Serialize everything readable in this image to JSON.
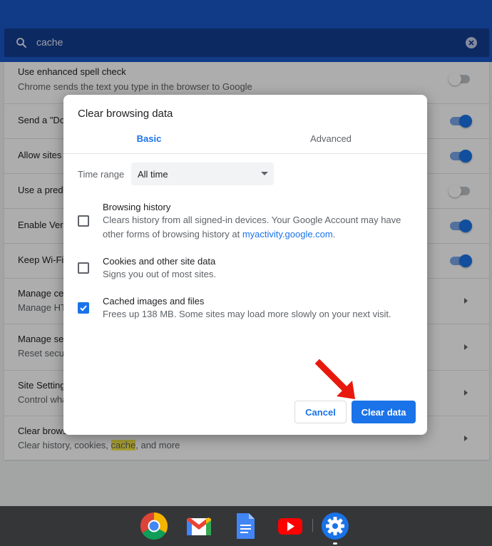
{
  "search": {
    "query": "cache"
  },
  "settings": {
    "rows": [
      {
        "title": "Use enhanced spell check",
        "subtitle": "Chrome sends the text you type in the browser to Google",
        "toggle": "off"
      },
      {
        "title": "Send a \"Do",
        "subtitle": "",
        "toggle": "on"
      },
      {
        "title": "Allow sites",
        "subtitle": "",
        "toggle": "on"
      },
      {
        "title": "Use a predi",
        "subtitle": "",
        "toggle": "off"
      },
      {
        "title": "Enable Veri",
        "subtitle": "",
        "toggle": "on"
      },
      {
        "title": "Keep Wi-Fi",
        "subtitle": "",
        "toggle": "on"
      },
      {
        "title": "Manage ce",
        "subtitle": "Manage HT",
        "toggle": "chevron"
      },
      {
        "title": "Manage se",
        "subtitle": "Reset secu",
        "toggle": "chevron"
      },
      {
        "title": "Site Setting",
        "subtitle": "Control wha",
        "toggle": "chevron"
      },
      {
        "title": "Clear brows",
        "subtitle_pre": "Clear history, cookies, ",
        "subtitle_hl": "cache",
        "subtitle_post": ", and more",
        "toggle": "chevron"
      }
    ]
  },
  "dialog": {
    "title": "Clear browsing data",
    "tabs": [
      "Basic",
      "Advanced"
    ],
    "time_range_label": "Time range",
    "time_range_value": "All time",
    "options": [
      {
        "title": "Browsing history",
        "desc_pre": "Clears history from all signed-in devices. Your Google Account may have other forms of browsing history at ",
        "desc_link": "myactivity.google.com",
        "desc_post": ".",
        "checked": false
      },
      {
        "title": "Cookies and other site data",
        "desc": "Signs you out of most sites.",
        "checked": false
      },
      {
        "title": "Cached images and files",
        "desc": "Frees up 138 MB. Some sites may load more slowly on your next visit.",
        "checked": true
      }
    ],
    "cancel_label": "Cancel",
    "clear_label": "Clear data"
  },
  "shelf": {
    "apps": [
      "chrome-icon",
      "gmail-icon",
      "docs-icon",
      "youtube-icon",
      "settings-icon"
    ]
  },
  "colors": {
    "accent": "#1a73e8",
    "header": "#1a56c8",
    "shelf": "#353638",
    "arrow": "#e8180c"
  }
}
